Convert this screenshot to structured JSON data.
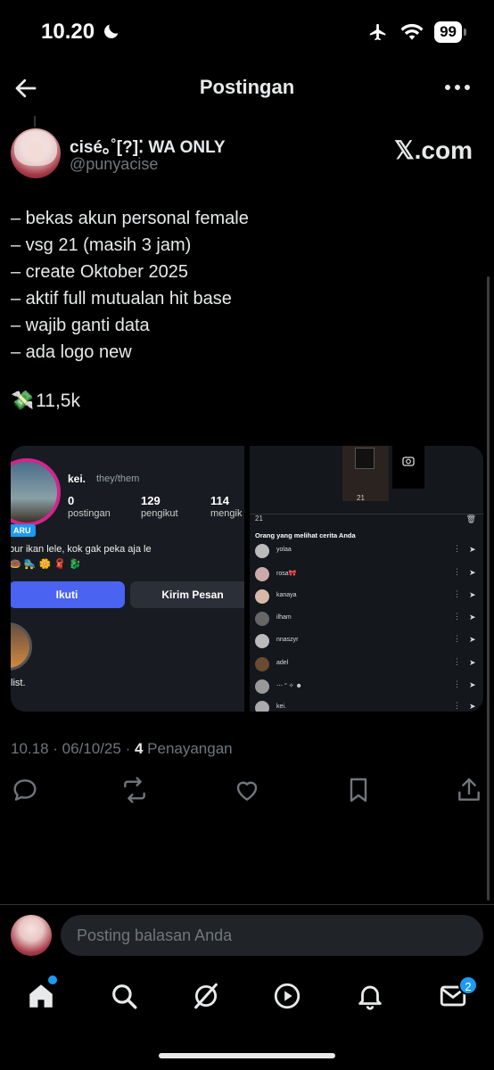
{
  "status_bar": {
    "time": "10.20",
    "battery": "99"
  },
  "header": {
    "title": "Postingan"
  },
  "author": {
    "name": "cisé｡˚[?]⁚ WA ONLY",
    "handle": "@punyacise",
    "source_logo": "𝕏.com"
  },
  "post": {
    "lines": [
      "– bekas akun personal female",
      "– vsg 21 (masih 3 jam)",
      "– create Oktober 2025",
      "– aktif full mutualan hit base",
      "– wajib ganti data",
      "– ada logo new"
    ],
    "price_emoji": "💸",
    "price": "11,5k"
  },
  "media": {
    "profile": {
      "username": "kei.",
      "pronouns": "they/them",
      "badge": "ARU",
      "stats": [
        {
          "value": "0",
          "label": "postingan"
        },
        {
          "value": "129",
          "label": "pengikut"
        },
        {
          "value": "114",
          "label": "mengik"
        }
      ],
      "bio": "bur ikan lele, kok gak peka aja le",
      "emoji_line": "🍩 🛼 🌼 🧣 🐉",
      "follow_label": "Ikuti",
      "message_label": "Kirim Pesan",
      "highlight_label": "list."
    },
    "story": {
      "count": "21",
      "views_count": "21",
      "viewers_title": "Orang yang melihat cerita Anda",
      "viewers": [
        "yolaa",
        "rosa🎀",
        "kanaya",
        "ilham",
        "nnaszyr",
        "adel",
        "⋯ ° ✧ ☻",
        "kei."
      ]
    }
  },
  "meta": {
    "time": "10.18",
    "sep1": " · ",
    "date": "06/10/25",
    "sep2": " · ",
    "views": "4",
    "views_label": " Penayangan"
  },
  "reply": {
    "placeholder": "Posting balasan Anda"
  },
  "nav": {
    "messages_badge": "2"
  },
  "colors": {
    "accent": "#1d9bf0",
    "muted": "#71767b",
    "text": "#e7e9ea",
    "follow": "#4a63f0"
  }
}
